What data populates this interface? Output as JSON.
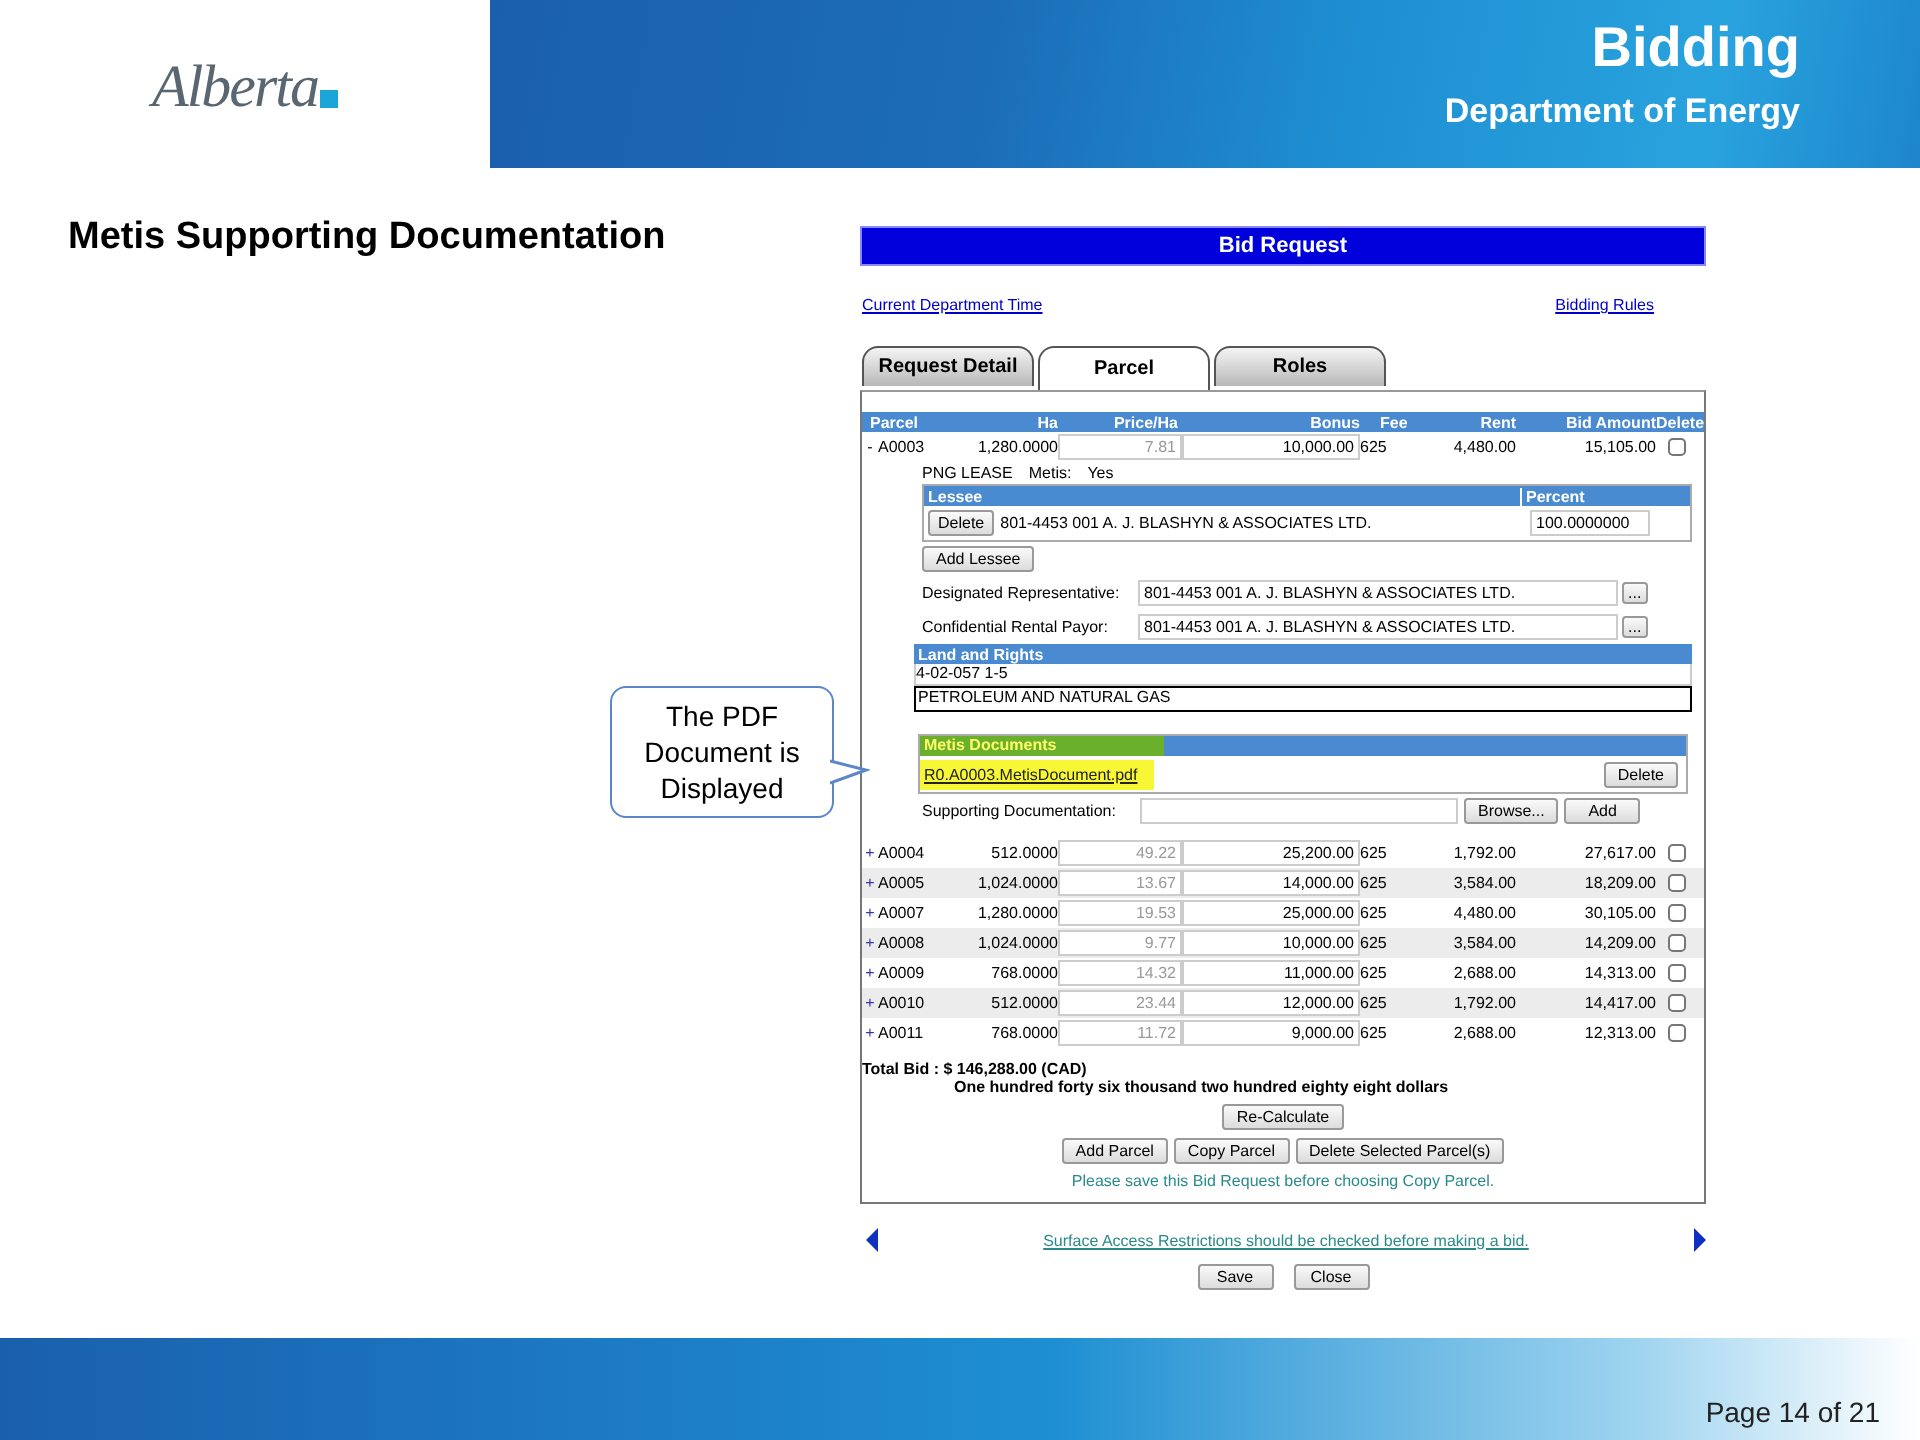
{
  "header": {
    "logo": "Alberta",
    "title": "Bidding",
    "subtitle": "Department of Energy"
  },
  "slide_title": "Metis Supporting Documentation",
  "callout": "The PDF Document is Displayed",
  "app": {
    "title": "Bid Request",
    "links": [
      "Current Department Time",
      "Bidding Rules"
    ],
    "tabs": [
      {
        "label": "Request Detail",
        "selected": false
      },
      {
        "label": "Parcel",
        "selected": true
      },
      {
        "label": "Roles",
        "selected": false
      }
    ],
    "columns": [
      "Parcel",
      "Ha",
      "Price/Ha",
      "Bonus",
      "Fee",
      "Rent",
      "Bid Amount",
      "Delete"
    ],
    "parcels": [
      {
        "toggle": "-",
        "parcel": "A0003",
        "ha": "1,280.0000",
        "price_ha": "7.81",
        "bonus": "10,000.00",
        "fee": "625",
        "rent": "4,480.00",
        "bid_amount": "15,105.00",
        "checked": false,
        "expanded": true
      },
      {
        "toggle": "+",
        "parcel": "A0004",
        "ha": "512.0000",
        "price_ha": "49.22",
        "bonus": "25,200.00",
        "fee": "625",
        "rent": "1,792.00",
        "bid_amount": "27,617.00",
        "checked": false,
        "expanded": false
      },
      {
        "toggle": "+",
        "parcel": "A0005",
        "ha": "1,024.0000",
        "price_ha": "13.67",
        "bonus": "14,000.00",
        "fee": "625",
        "rent": "3,584.00",
        "bid_amount": "18,209.00",
        "checked": false,
        "expanded": false
      },
      {
        "toggle": "+",
        "parcel": "A0007",
        "ha": "1,280.0000",
        "price_ha": "19.53",
        "bonus": "25,000.00",
        "fee": "625",
        "rent": "4,480.00",
        "bid_amount": "30,105.00",
        "checked": false,
        "expanded": false
      },
      {
        "toggle": "+",
        "parcel": "A0008",
        "ha": "1,024.0000",
        "price_ha": "9.77",
        "bonus": "10,000.00",
        "fee": "625",
        "rent": "3,584.00",
        "bid_amount": "14,209.00",
        "checked": false,
        "expanded": false
      },
      {
        "toggle": "+",
        "parcel": "A0009",
        "ha": "768.0000",
        "price_ha": "14.32",
        "bonus": "11,000.00",
        "fee": "625",
        "rent": "2,688.00",
        "bid_amount": "14,313.00",
        "checked": false,
        "expanded": false
      },
      {
        "toggle": "+",
        "parcel": "A0010",
        "ha": "512.0000",
        "price_ha": "23.44",
        "bonus": "12,000.00",
        "fee": "625",
        "rent": "1,792.00",
        "bid_amount": "14,417.00",
        "checked": false,
        "expanded": false
      },
      {
        "toggle": "+",
        "parcel": "A0011",
        "ha": "768.0000",
        "price_ha": "11.72",
        "bonus": "9,000.00",
        "fee": "625",
        "rent": "2,688.00",
        "bid_amount": "12,313.00",
        "checked": false,
        "expanded": false
      }
    ],
    "detail": {
      "lease_type": "PNG  LEASE",
      "metis_label": "Metis:",
      "metis_value": "Yes",
      "lessee_header": "Lessee",
      "percent_header": "Percent",
      "lessee_delete": "Delete",
      "lessee": "801-4453 001 A. J. BLASHYN & ASSOCIATES LTD.",
      "percent": "100.0000000",
      "add_lessee": "Add Lessee",
      "fields": [
        {
          "label": "Designated Representative:",
          "value": "801-4453 001 A. J. BLASHYN & ASSOCIATES LTD.",
          "button": "..."
        },
        {
          "label": "Confidential Rental Payor:",
          "value": "801-4453 001 A. J. BLASHYN & ASSOCIATES LTD.",
          "button": "..."
        }
      ],
      "land_header": "Land and Rights",
      "land_code": "4-02-057 1-5",
      "land_rights": "PETROLEUM AND NATURAL GAS",
      "metis_header": "Metis Documents",
      "metis_file": "R0.A0003.MetisDocument.pdf",
      "metis_delete": "Delete",
      "support_label": "Supporting Documentation:",
      "browse": "Browse...",
      "add": "Add"
    },
    "total": "Total Bid : $ 146,288.00 (CAD)",
    "total_words": "One hundred forty six thousand two hundred eighty eight dollars",
    "recalculate": "Re-Calculate",
    "actions": [
      "Add Parcel",
      "Copy Parcel",
      "Delete Selected Parcel(s)"
    ],
    "note": "Please save this Bid Request before choosing Copy Parcel.",
    "surface_link": "Surface Access Restrictions should be checked before making a bid.",
    "footer_buttons": [
      "Save",
      "Close"
    ]
  },
  "footer": {
    "page": "Page 14 of 21"
  }
}
